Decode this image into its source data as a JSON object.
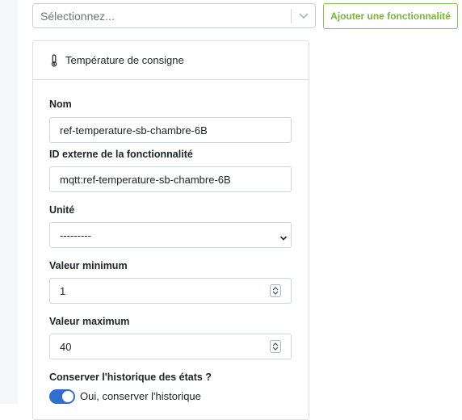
{
  "feature_select": {
    "placeholder": "Sélectionnez..."
  },
  "add_feature_button": {
    "label": "Ajouter une fonctionnalité"
  },
  "feature_card": {
    "title": "Température de consigne",
    "icon": "thermometer-icon",
    "name": {
      "label": "Nom",
      "value": "ref-temperature-sb-chambre-6B"
    },
    "external_id": {
      "label": "ID externe de la fonctionnalité",
      "value": "mqtt:ref-temperature-sb-chambre-6B"
    },
    "unit": {
      "label": "Unité",
      "value": "---------"
    },
    "min_value": {
      "label": "Valeur minimum",
      "value": "1"
    },
    "max_value": {
      "label": "Valeur maximum",
      "value": "40"
    },
    "keep_history": {
      "label": "Conserver l'historique des états ?",
      "toggle_label": "Oui, conserver l'historique",
      "enabled": true
    }
  },
  "colors": {
    "accent_green": "#75b63b",
    "toggle_blue": "#2f6fd1"
  }
}
